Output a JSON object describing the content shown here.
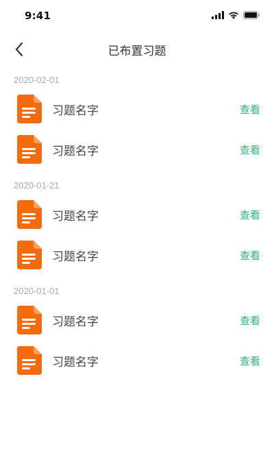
{
  "status_bar": {
    "time": "9:41"
  },
  "nav": {
    "title": "已布置习题"
  },
  "colors": {
    "doc_icon": "#f26b0f",
    "view_link": "#2bb673",
    "date_text": "#aaaaaa"
  },
  "groups": [
    {
      "date": "2020-02-01",
      "items": [
        {
          "name": "习题名字",
          "action": "查看"
        },
        {
          "name": "习题名字",
          "action": "查看"
        }
      ]
    },
    {
      "date": "2020-01-21",
      "items": [
        {
          "name": "习题名字",
          "action": "查看"
        },
        {
          "name": "习题名字",
          "action": "查看"
        }
      ]
    },
    {
      "date": "2020-01-01",
      "items": [
        {
          "name": "习题名字",
          "action": "查看"
        },
        {
          "name": "习题名字",
          "action": "查看"
        }
      ]
    }
  ]
}
